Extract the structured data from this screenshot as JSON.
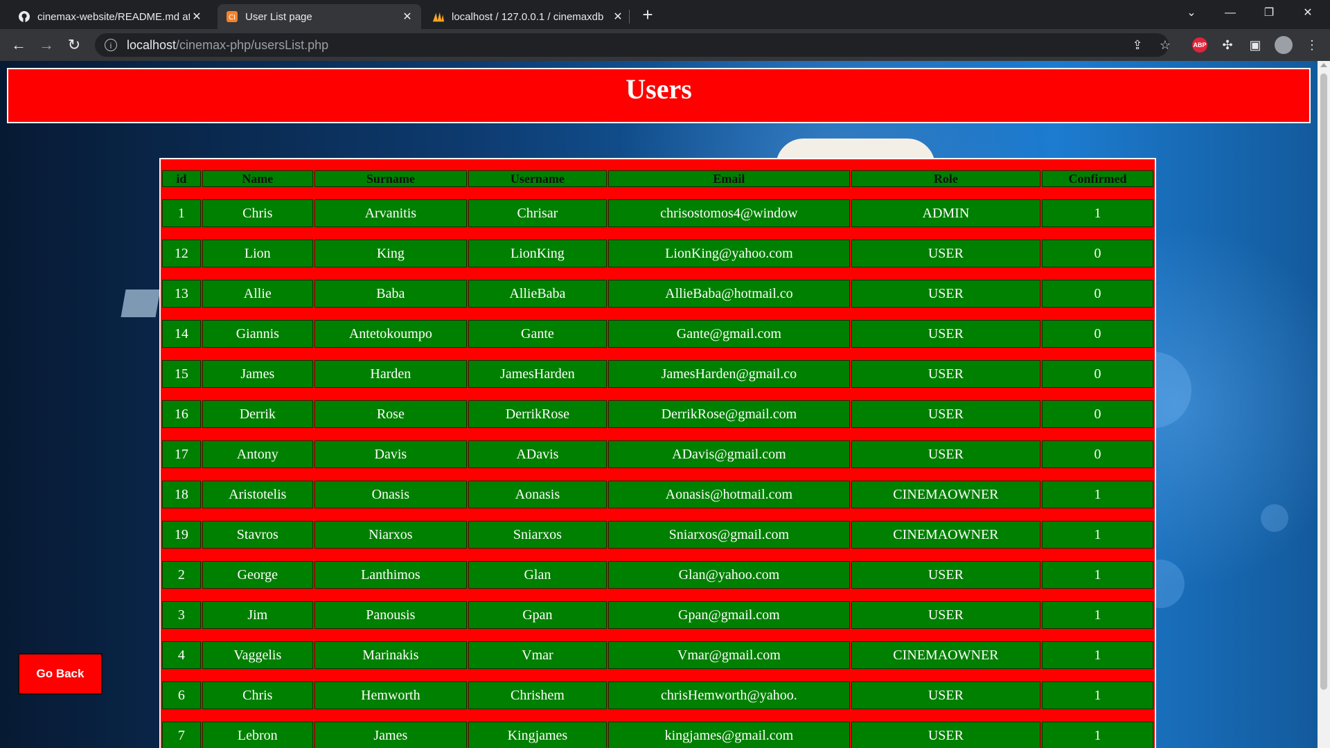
{
  "browser": {
    "tabs": [
      {
        "title": "cinemax-website/README.md at",
        "favicon": "github-icon",
        "active": false
      },
      {
        "title": "User List page",
        "favicon": "codeigniter-icon",
        "active": true
      },
      {
        "title": "localhost / 127.0.0.1 / cinemaxdb",
        "favicon": "phpmyadmin-icon",
        "active": false
      }
    ],
    "url_host": "localhost",
    "url_path": "/cinemax-php/usersList.php"
  },
  "page": {
    "title": "Users",
    "go_back_label": "Go Back",
    "colors": {
      "header_bg": "#ff0000",
      "cell_bg": "#008000",
      "button_bg": "#ff0000"
    }
  },
  "table": {
    "headers": [
      "id",
      "Name",
      "Surname",
      "Username",
      "Email",
      "Role",
      "Confirmed"
    ],
    "rows": [
      [
        "1",
        "Chris",
        "Arvanitis",
        "Chrisar",
        "chrisostomos4@window",
        "ADMIN",
        "1"
      ],
      [
        "12",
        "Lion",
        "King",
        "LionKing",
        "LionKing@yahoo.com",
        "USER",
        "0"
      ],
      [
        "13",
        "Allie",
        "Baba",
        "AllieBaba",
        "AllieBaba@hotmail.co",
        "USER",
        "0"
      ],
      [
        "14",
        "Giannis",
        "Antetokoumpo",
        "Gante",
        "Gante@gmail.com",
        "USER",
        "0"
      ],
      [
        "15",
        "James",
        "Harden",
        "JamesHarden",
        "JamesHarden@gmail.co",
        "USER",
        "0"
      ],
      [
        "16",
        "Derrik",
        "Rose",
        "DerrikRose",
        "DerrikRose@gmail.com",
        "USER",
        "0"
      ],
      [
        "17",
        "Antony",
        "Davis",
        "ADavis",
        "ADavis@gmail.com",
        "USER",
        "0"
      ],
      [
        "18",
        "Aristotelis",
        "Onasis",
        "Aonasis",
        "Aonasis@hotmail.com",
        "CINEMAOWNER",
        "1"
      ],
      [
        "19",
        "Stavros",
        "Niarxos",
        "Sniarxos",
        "Sniarxos@gmail.com",
        "CINEMAOWNER",
        "1"
      ],
      [
        "2",
        "George",
        "Lanthimos",
        "Glan",
        "Glan@yahoo.com",
        "USER",
        "1"
      ],
      [
        "3",
        "Jim",
        "Panousis",
        "Gpan",
        "Gpan@gmail.com",
        "USER",
        "1"
      ],
      [
        "4",
        "Vaggelis",
        "Marinakis",
        "Vmar",
        "Vmar@gmail.com",
        "CINEMAOWNER",
        "1"
      ],
      [
        "6",
        "Chris",
        "Hemworth",
        "Chrishem",
        "chrisHemworth@yahoo.",
        "USER",
        "1"
      ],
      [
        "7",
        "Lebron",
        "James",
        "Kingjames",
        "kingjames@gmail.com",
        "USER",
        "1"
      ]
    ]
  }
}
